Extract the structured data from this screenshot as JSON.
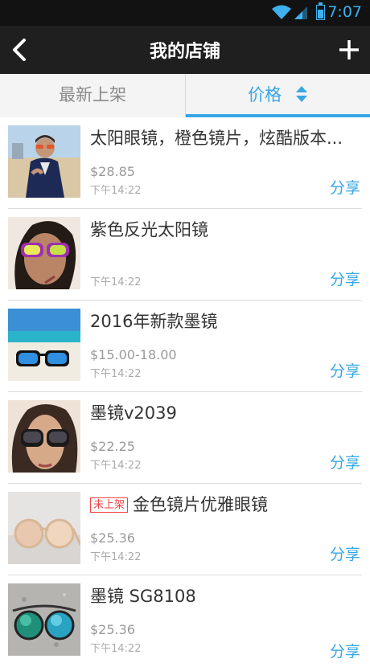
{
  "status": {
    "time": "7:07"
  },
  "header": {
    "title": "我的店铺"
  },
  "tabs": {
    "newest": "最新上架",
    "price": "价格"
  },
  "items": [
    {
      "name": "太阳眼镜，橙色镜片，炫酷版本...",
      "price": "$28.85",
      "time": "下午14:22",
      "share": "分享",
      "badge": ""
    },
    {
      "name": "紫色反光太阳镜",
      "price": "",
      "time": "下午14:22",
      "share": "分享",
      "badge": ""
    },
    {
      "name": "2016年新款墨镜",
      "price": "$15.00-18.00",
      "time": "下午14:22",
      "share": "分享",
      "badge": ""
    },
    {
      "name": "墨镜v2039",
      "price": "$22.25",
      "time": "下午14:22",
      "share": "分享",
      "badge": ""
    },
    {
      "name": "金色镜片优雅眼镜",
      "price": "$25.36",
      "time": "下午14:22",
      "share": "分享",
      "badge": "未上架"
    },
    {
      "name": "墨镜 SG8108",
      "price": "$25.36",
      "time": "下午14:22",
      "share": "分享",
      "badge": ""
    }
  ],
  "colors": {
    "accent": "#37a6e6",
    "navbar": "#1f1f1f",
    "statusbar": "#121212"
  }
}
